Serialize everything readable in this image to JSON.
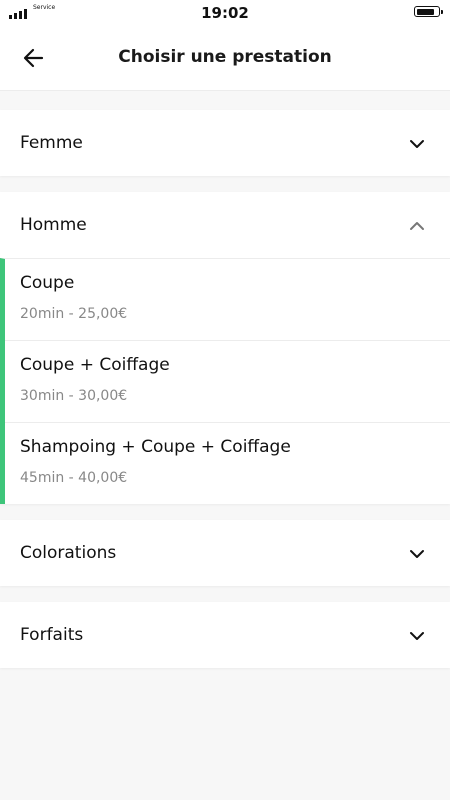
{
  "status_bar": {
    "carrier": "Service",
    "time": "19:02",
    "battery_level": 0.85
  },
  "header": {
    "title": "Choisir une prestation",
    "back_icon": "arrow-left-icon"
  },
  "categories": [
    {
      "label": "Femme",
      "expanded": false
    },
    {
      "label": "Homme",
      "expanded": true,
      "services": [
        {
          "name": "Coupe",
          "info": "20min - 25,00€"
        },
        {
          "name": "Coupe + Coiffage",
          "info": "30min - 30,00€"
        },
        {
          "name": "Shampoing + Coupe + Coiffage",
          "info": "45min - 40,00€"
        }
      ]
    },
    {
      "label": "Colorations",
      "expanded": false
    },
    {
      "label": "Forfaits",
      "expanded": false
    }
  ],
  "colors": {
    "accent": "#3ec57a",
    "background": "#f7f7f7",
    "card": "#ffffff",
    "secondary_text": "#888888"
  }
}
